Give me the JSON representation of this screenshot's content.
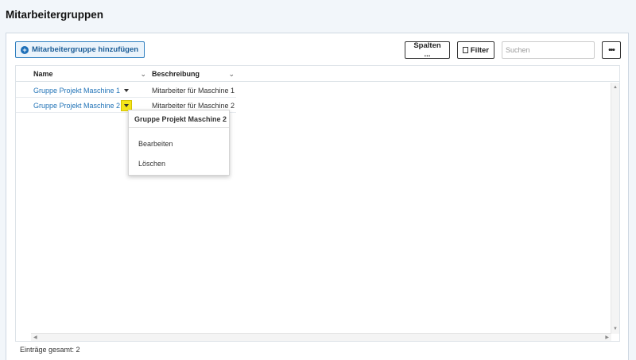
{
  "page": {
    "title": "Mitarbeitergruppen"
  },
  "toolbar": {
    "add_label": "Mitarbeitergruppe hinzufügen",
    "add_icon": "plus-circle-icon",
    "columns_label": "Spalten ...",
    "filter_label": "Filter",
    "search_placeholder": "Suchen",
    "search_value": "",
    "more_label": "•••"
  },
  "grid": {
    "columns": [
      {
        "label": "Name"
      },
      {
        "label": "Beschreibung"
      }
    ],
    "rows": [
      {
        "name": "Gruppe Projekt Maschine 1",
        "description": "Mitarbeiter für Maschine 1"
      },
      {
        "name": "Gruppe Projekt Maschine 2",
        "description": "Mitarbeiter für Maschine 2"
      }
    ],
    "total_label": "Einträge gesamt: 2"
  },
  "dropdown": {
    "title": "Gruppe Projekt Maschine 2",
    "items": [
      {
        "label": "Bearbeiten"
      },
      {
        "label": "Löschen"
      }
    ]
  },
  "colors": {
    "accent": "#2475b8",
    "highlight": "#f5e51a",
    "background": "#f2f6fa"
  }
}
